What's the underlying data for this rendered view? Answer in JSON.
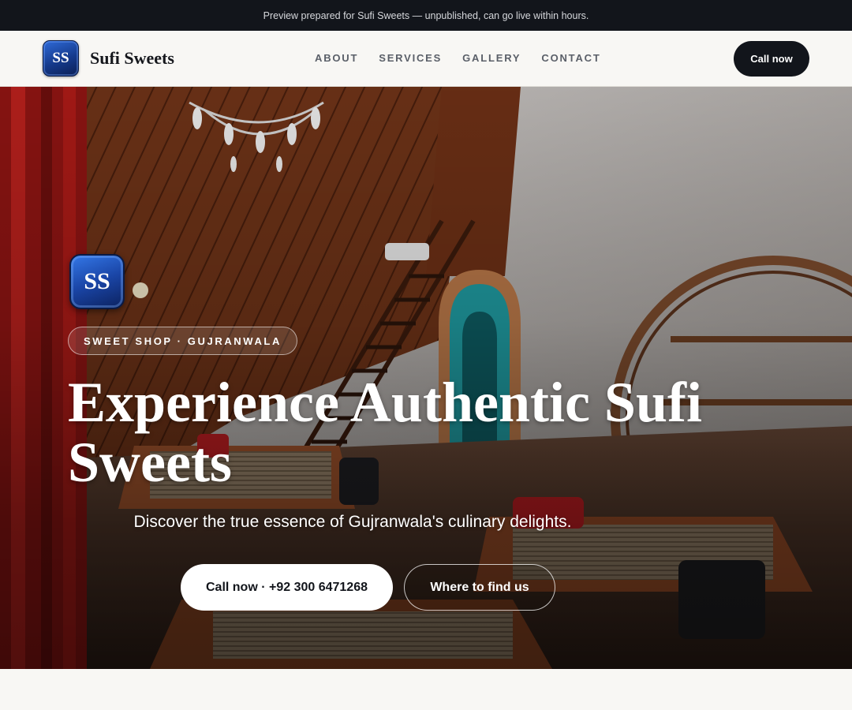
{
  "notice": {
    "text": "Preview prepared for Sufi Sweets — unpublished, can go live within hours."
  },
  "header": {
    "logo_initials": "SS",
    "brand_name": "Sufi Sweets",
    "nav": [
      {
        "label": "ABOUT"
      },
      {
        "label": "SERVICES"
      },
      {
        "label": "GALLERY"
      },
      {
        "label": "CONTACT"
      }
    ],
    "call_label": "Call now"
  },
  "hero": {
    "logo_initials": "SS",
    "tag": "SWEET SHOP · GUJRANWALA",
    "headline": "Experience Authentic Sufi Sweets",
    "subline": "Discover the true essence of Gujranwala's culinary delights.",
    "primary_button": "Call now · +92 300 6471268",
    "secondary_button": "Where to find us",
    "background_image": "restaurant-interior-photo"
  },
  "colors": {
    "dark": "#12151b",
    "logo_blue": "#1a45a6",
    "page_bg": "#f8f7f4"
  }
}
